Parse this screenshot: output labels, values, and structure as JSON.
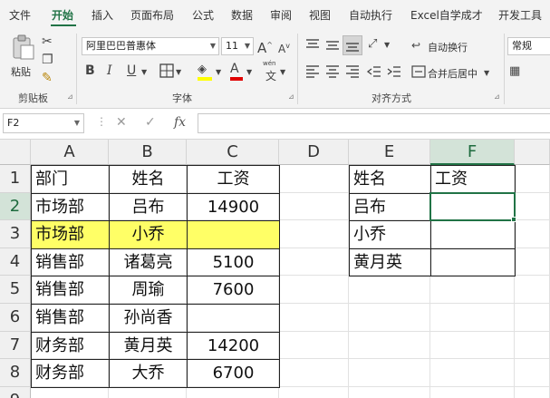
{
  "tabs": [
    "文件",
    "开始",
    "插入",
    "页面布局",
    "公式",
    "数据",
    "审阅",
    "视图",
    "自动执行",
    "Excel自学成才",
    "开发工具"
  ],
  "clipboard": {
    "paste_label": "粘贴",
    "group_label": "剪贴板"
  },
  "font": {
    "name": "阿里巴巴普惠体",
    "size": "11",
    "grow": "A",
    "shrink": "A",
    "bold": "B",
    "italic": "I",
    "underline": "U",
    "font_color_glyph": "A",
    "wen_top": "wén",
    "wen_bottom": "文",
    "group_label": "字体"
  },
  "alignment": {
    "wrap_label": "自动换行",
    "merge_label": "合并后居中",
    "group_label": "对齐方式"
  },
  "number": {
    "format": "常规"
  },
  "formula_bar": {
    "cell_ref": "F2",
    "fx": "fx",
    "cancel": "✕",
    "confirm": "✓",
    "dots": "⋮",
    "content": ""
  },
  "grid": {
    "columns": [
      "A",
      "B",
      "C",
      "D",
      "E",
      "F"
    ],
    "selected_column": "F",
    "rows": [
      "1",
      "2",
      "3",
      "4",
      "5",
      "6",
      "7",
      "8",
      "9"
    ],
    "selected_row": "2",
    "table1": {
      "headers": [
        "部门",
        "姓名",
        "工资"
      ],
      "rows": [
        [
          "市场部",
          "吕布",
          "14900"
        ],
        [
          "市场部",
          "小乔",
          ""
        ],
        [
          "销售部",
          "诸葛亮",
          "5100"
        ],
        [
          "销售部",
          "周瑜",
          "7600"
        ],
        [
          "销售部",
          "孙尚香",
          ""
        ],
        [
          "财务部",
          "黄月英",
          "14200"
        ],
        [
          "财务部",
          "大乔",
          "6700"
        ]
      ],
      "highlight_color": "#ffff66"
    },
    "table2": {
      "headers": [
        "姓名",
        "工资"
      ],
      "rows": [
        [
          "吕布",
          ""
        ],
        [
          "小乔",
          ""
        ],
        [
          "黄月英",
          ""
        ]
      ]
    }
  },
  "colors": {
    "accent": "#217346",
    "highlight": "#ffff66",
    "font_color": "#e00000",
    "fill_color": "#ffff00"
  }
}
